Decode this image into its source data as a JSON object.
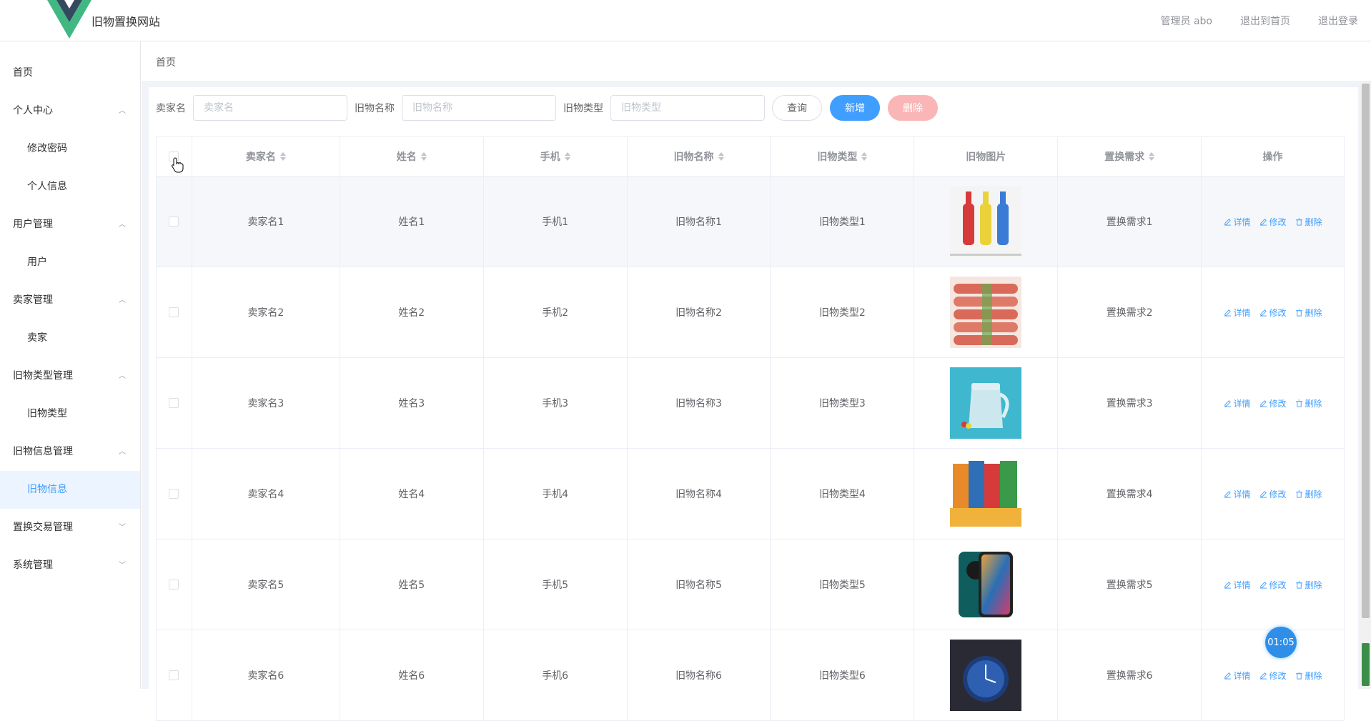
{
  "header": {
    "site_title": "旧物置换网站",
    "admin_label": "管理员 abo",
    "back_home": "退出到首页",
    "logout": "退出登录",
    "logo_colors": {
      "outer": "#41b883",
      "inner": "#34495e"
    }
  },
  "sidebar": {
    "items": [
      {
        "label": "首页"
      },
      {
        "label": "个人中心",
        "sub": [
          "修改密码",
          "个人信息"
        ]
      },
      {
        "label": "用户管理",
        "sub": [
          "用户"
        ]
      },
      {
        "label": "卖家管理",
        "sub": [
          "卖家"
        ]
      },
      {
        "label": "旧物类型管理",
        "sub": [
          "旧物类型"
        ]
      },
      {
        "label": "旧物信息管理",
        "sub": [
          "旧物信息"
        ]
      },
      {
        "label": "置换交易管理"
      },
      {
        "label": "系统管理"
      }
    ],
    "active": "旧物信息"
  },
  "breadcrumb": "首页",
  "search": {
    "seller_label": "卖家名",
    "seller_placeholder": "卖家名",
    "item_label": "旧物名称",
    "item_placeholder": "旧物名称",
    "type_label": "旧物类型",
    "type_placeholder": "旧物类型",
    "query_btn": "查询",
    "add_btn": "新增",
    "delete_btn": "删除"
  },
  "table": {
    "headers": [
      "卖家名",
      "姓名",
      "手机",
      "旧物名称",
      "旧物类型",
      "旧物图片",
      "置换需求",
      "操作"
    ],
    "rows": [
      [
        "卖家名1",
        "姓名1",
        "手机1",
        "旧物名称1",
        "旧物类型1",
        "置换需求1"
      ],
      [
        "卖家名2",
        "姓名2",
        "手机2",
        "旧物名称2",
        "旧物类型2",
        "置换需求2"
      ],
      [
        "卖家名3",
        "姓名3",
        "手机3",
        "旧物名称3",
        "旧物类型3",
        "置换需求3"
      ],
      [
        "卖家名4",
        "姓名4",
        "手机4",
        "旧物名称4",
        "旧物类型4",
        "置换需求4"
      ],
      [
        "卖家名5",
        "姓名5",
        "手机5",
        "旧物名称5",
        "旧物类型5",
        "置换需求5"
      ],
      [
        "卖家名6",
        "姓名6",
        "手机6",
        "旧物名称6",
        "旧物类型6",
        "置换需求6"
      ]
    ],
    "images": [
      "bottles",
      "sausages",
      "kettle",
      "snacks",
      "phone",
      "watch"
    ],
    "ops": {
      "detail": "详情",
      "edit": "修改",
      "delete": "删除"
    }
  },
  "timer": "01:05",
  "colors": {
    "primary": "#409eff",
    "danger_light": "#fab6b6",
    "active_bg": "#ecf5ff"
  }
}
